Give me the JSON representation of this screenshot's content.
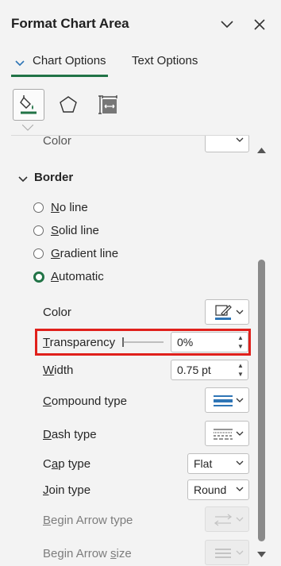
{
  "pane": {
    "title": "Format Chart Area",
    "icons": {
      "collapse": "chevron-down-icon",
      "close": "close-icon"
    }
  },
  "tabs": [
    {
      "label": "Chart Options",
      "active": true
    },
    {
      "label": "Text Options",
      "active": false
    }
  ],
  "categories": [
    {
      "icon": "fill-line-icon",
      "selected": true
    },
    {
      "icon": "effects-pentagon-icon",
      "selected": false
    },
    {
      "icon": "size-properties-icon",
      "selected": false
    }
  ],
  "fill_section": {
    "color_label": "Color"
  },
  "border": {
    "header": "Border",
    "options": [
      {
        "label": "No line",
        "checked": false
      },
      {
        "label": "Solid line",
        "checked": false
      },
      {
        "label": "Gradient line",
        "checked": false
      },
      {
        "label": "Automatic",
        "checked": true
      }
    ],
    "color_label": "Color",
    "transparency_label": "Transparency",
    "transparency_value": "0%",
    "width_label": "Width",
    "width_value": "0.75 pt",
    "compound_label": "Compound type",
    "dash_label": "Dash type",
    "cap_label": "Cap type",
    "cap_value": "Flat",
    "join_label": "Join type",
    "join_value": "Round",
    "begin_arrow_type_label": "Begin Arrow type",
    "begin_arrow_size_label": "Begin Arrow size"
  },
  "colors": {
    "accent": "#217346",
    "highlight": "#e0201b",
    "line_blue": "#2e75b6"
  }
}
